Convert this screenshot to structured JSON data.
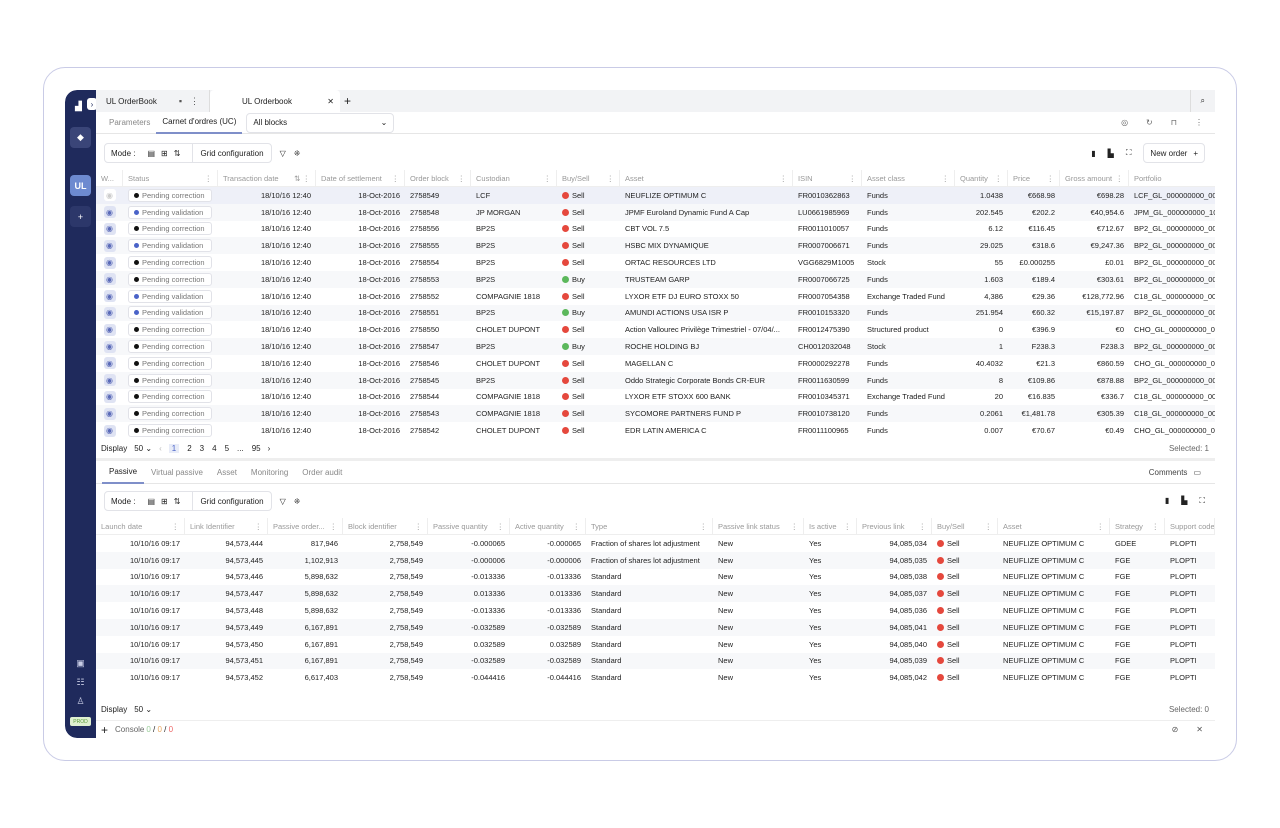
{
  "sidebar": {
    "logo": "chart-logo",
    "badge": "UL",
    "env": "PROD"
  },
  "tabs": [
    {
      "label": "UL OrderBook"
    },
    {
      "label": "UL Orderbook"
    }
  ],
  "subtabs": {
    "parameters": "Parameters",
    "carnet": "Carnet d'ordres (UC)",
    "filter": "All blocks"
  },
  "toolbar": {
    "mode": "Mode :",
    "grid_config": "Grid configuration",
    "new_order": "New order"
  },
  "orders": {
    "columns": [
      "W...",
      "Status",
      "Transaction date",
      "Date of settlement",
      "Order block",
      "Custodian",
      "Buy/Sell",
      "Asset",
      "ISIN",
      "Asset class",
      "Quantity",
      "Price",
      "Gross amount",
      "Portfolio"
    ],
    "rows": [
      [
        "Pending correction",
        "18/10/16 12:40",
        "18-Oct-2016",
        "2758549",
        "LCF",
        "Sell",
        "NEUFLIZE OPTIMUM C",
        "FR0010362863",
        "Funds",
        "1.0438",
        "€668.98",
        "€698.28",
        "LCF_GL_000000000_00"
      ],
      [
        "Pending validation",
        "18/10/16 12:40",
        "18-Oct-2016",
        "2758548",
        "JP MORGAN",
        "Sell",
        "JPMF Euroland Dynamic Fund A Cap",
        "LU0661985969",
        "Funds",
        "202.545",
        "€202.2",
        "€40,954.6",
        "JPM_GL_000000000_10"
      ],
      [
        "Pending correction",
        "18/10/16 12:40",
        "18-Oct-2016",
        "2758556",
        "BP2S",
        "Sell",
        "CBT VOL 7.5",
        "FR0011010057",
        "Funds",
        "6.12",
        "€116.45",
        "€712.67",
        "BP2_GL_000000000_00"
      ],
      [
        "Pending validation",
        "18/10/16 12:40",
        "18-Oct-2016",
        "2758555",
        "BP2S",
        "Sell",
        "HSBC MIX DYNAMIQUE",
        "FR0007006671",
        "Funds",
        "29.025",
        "€318.6",
        "€9,247.36",
        "BP2_GL_000000000_00"
      ],
      [
        "Pending correction",
        "18/10/16 12:40",
        "18-Oct-2016",
        "2758554",
        "BP2S",
        "Sell",
        "ORTAC RESOURCES LTD",
        "VGG6829M1005",
        "Stock",
        "55",
        "£0.000255",
        "£0.01",
        "BP2_GL_000000000_00"
      ],
      [
        "Pending correction",
        "18/10/16 12:40",
        "18-Oct-2016",
        "2758553",
        "BP2S",
        "Buy",
        "TRUSTEAM GARP",
        "FR0007066725",
        "Funds",
        "1.603",
        "€189.4",
        "€303.61",
        "BP2_GL_000000000_00"
      ],
      [
        "Pending validation",
        "18/10/16 12:40",
        "18-Oct-2016",
        "2758552",
        "COMPAGNIE 1818",
        "Sell",
        "LYXOR ETF DJ EURO STOXX 50",
        "FR0007054358",
        "Exchange Traded Fund",
        "4,386",
        "€29.36",
        "€128,772.96",
        "C18_GL_000000000_00"
      ],
      [
        "Pending validation",
        "18/10/16 12:40",
        "18-Oct-2016",
        "2758551",
        "BP2S",
        "Buy",
        "AMUNDI ACTIONS USA ISR P",
        "FR0010153320",
        "Funds",
        "251.954",
        "€60.32",
        "€15,197.87",
        "BP2_GL_000000000_00"
      ],
      [
        "Pending correction",
        "18/10/16 12:40",
        "18-Oct-2016",
        "2758550",
        "CHOLET DUPONT",
        "Sell",
        "Action Vallourec Privilège Trimestriel - 07/04/...",
        "FR0012475390",
        "Structured product",
        "0",
        "€396.9",
        "€0",
        "CHO_GL_000000000_00"
      ],
      [
        "Pending correction",
        "18/10/16 12:40",
        "18-Oct-2016",
        "2758547",
        "BP2S",
        "Buy",
        "ROCHE HOLDING BJ",
        "CH0012032048",
        "Stock",
        "1",
        "F238.3",
        "F238.3",
        "BP2_GL_000000000_00"
      ],
      [
        "Pending correction",
        "18/10/16 12:40",
        "18-Oct-2016",
        "2758546",
        "CHOLET DUPONT",
        "Sell",
        "MAGELLAN C",
        "FR0000292278",
        "Funds",
        "40.4032",
        "€21.3",
        "€860.59",
        "CHO_GL_000000000_00"
      ],
      [
        "Pending correction",
        "18/10/16 12:40",
        "18-Oct-2016",
        "2758545",
        "BP2S",
        "Sell",
        "Oddo Strategic Corporate Bonds CR-EUR",
        "FR0011630599",
        "Funds",
        "8",
        "€109.86",
        "€878.88",
        "BP2_GL_000000000_00"
      ],
      [
        "Pending correction",
        "18/10/16 12:40",
        "18-Oct-2016",
        "2758544",
        "COMPAGNIE 1818",
        "Sell",
        "LYXOR ETF STOXX 600 BANK",
        "FR0010345371",
        "Exchange Traded Fund",
        "20",
        "€16.835",
        "€336.7",
        "C18_GL_000000000_00"
      ],
      [
        "Pending correction",
        "18/10/16 12:40",
        "18-Oct-2016",
        "2758543",
        "COMPAGNIE 1818",
        "Sell",
        "SYCOMORE PARTNERS FUND P",
        "FR0010738120",
        "Funds",
        "0.2061",
        "€1,481.78",
        "€305.39",
        "C18_GL_000000000_00"
      ],
      [
        "Pending correction",
        "18/10/16 12:40",
        "18-Oct-2016",
        "2758542",
        "CHOLET DUPONT",
        "Sell",
        "EDR LATIN AMERICA C",
        "FR0011100965",
        "Funds",
        "0.007",
        "€70.67",
        "€0.49",
        "CHO_GL_000000000_00"
      ]
    ],
    "display_label": "Display",
    "page_size": "50",
    "pages": [
      "1",
      "2",
      "3",
      "4",
      "5",
      "...",
      "95"
    ],
    "selected": "Selected: 1"
  },
  "bottom_tabs": [
    "Passive",
    "Virtual passive",
    "Asset",
    "Monitoring",
    "Order audit"
  ],
  "comments": "Comments",
  "passive": {
    "columns": [
      "Launch date",
      "Link Identifier",
      "Passive order...",
      "Block identifier",
      "Passive quantity",
      "Active quantity",
      "Type",
      "Passive link status",
      "Is active",
      "Previous link",
      "Buy/Sell",
      "Asset",
      "Strategy",
      "Support code"
    ],
    "rows": [
      [
        "10/10/16 09:17",
        "94,573,444",
        "817,946",
        "2,758,549",
        "-0.000065",
        "-0.000065",
        "Fraction of shares lot adjustment",
        "New",
        "Yes",
        "94,085,034",
        "Sell",
        "NEUFLIZE OPTIMUM C",
        "GDEE",
        "PLOPTI"
      ],
      [
        "10/10/16 09:17",
        "94,573,445",
        "1,102,913",
        "2,758,549",
        "-0.000006",
        "-0.000006",
        "Fraction of shares lot adjustment",
        "New",
        "Yes",
        "94,085,035",
        "Sell",
        "NEUFLIZE OPTIMUM C",
        "FGE",
        "PLOPTI"
      ],
      [
        "10/10/16 09:17",
        "94,573,446",
        "5,898,632",
        "2,758,549",
        "-0.013336",
        "-0.013336",
        "Standard",
        "New",
        "Yes",
        "94,085,038",
        "Sell",
        "NEUFLIZE OPTIMUM C",
        "FGE",
        "PLOPTI"
      ],
      [
        "10/10/16 09:17",
        "94,573,447",
        "5,898,632",
        "2,758,549",
        "0.013336",
        "0.013336",
        "Standard",
        "New",
        "Yes",
        "94,085,037",
        "Sell",
        "NEUFLIZE OPTIMUM C",
        "FGE",
        "PLOPTI"
      ],
      [
        "10/10/16 09:17",
        "94,573,448",
        "5,898,632",
        "2,758,549",
        "-0.013336",
        "-0.013336",
        "Standard",
        "New",
        "Yes",
        "94,085,036",
        "Sell",
        "NEUFLIZE OPTIMUM C",
        "FGE",
        "PLOPTI"
      ],
      [
        "10/10/16 09:17",
        "94,573,449",
        "6,167,891",
        "2,758,549",
        "-0.032589",
        "-0.032589",
        "Standard",
        "New",
        "Yes",
        "94,085,041",
        "Sell",
        "NEUFLIZE OPTIMUM C",
        "FGE",
        "PLOPTI"
      ],
      [
        "10/10/16 09:17",
        "94,573,450",
        "6,167,891",
        "2,758,549",
        "0.032589",
        "0.032589",
        "Standard",
        "New",
        "Yes",
        "94,085,040",
        "Sell",
        "NEUFLIZE OPTIMUM C",
        "FGE",
        "PLOPTI"
      ],
      [
        "10/10/16 09:17",
        "94,573,451",
        "6,167,891",
        "2,758,549",
        "-0.032589",
        "-0.032589",
        "Standard",
        "New",
        "Yes",
        "94,085,039",
        "Sell",
        "NEUFLIZE OPTIMUM C",
        "FGE",
        "PLOPTI"
      ],
      [
        "10/10/16 09:17",
        "94,573,452",
        "6,617,403",
        "2,758,549",
        "-0.044416",
        "-0.044416",
        "Standard",
        "New",
        "Yes",
        "94,085,042",
        "Sell",
        "NEUFLIZE OPTIMUM C",
        "FGE",
        "PLOPTI"
      ]
    ],
    "display_label": "Display",
    "page_size": "50",
    "selected": "Selected: 0"
  },
  "console": {
    "label": "Console",
    "a": "0",
    "b": "0",
    "c": "0"
  },
  "colors": {
    "sell": "#e5483d",
    "buy": "#5cb85c",
    "navy": "#1f2a5c",
    "validation": "#4a63c8",
    "correction": "#111111"
  }
}
